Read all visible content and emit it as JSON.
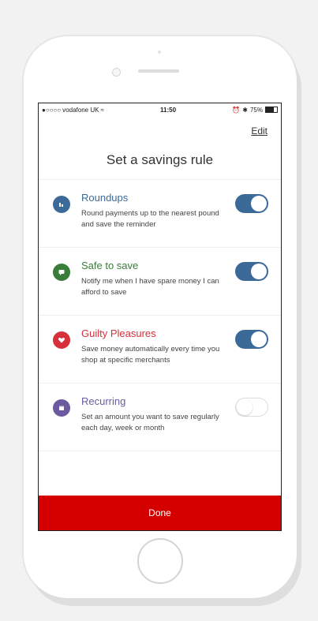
{
  "status": {
    "signal": "●○○○○",
    "carrier": "vodafone UK",
    "wifi": "≈",
    "time": "11:50",
    "alarm": "⏰",
    "bluetooth": "✱",
    "battery": "75%"
  },
  "header": {
    "edit_label": "Edit",
    "title": "Set a savings rule"
  },
  "rules": [
    {
      "name": "Roundups",
      "description": "Round payments up to the nearest pound and save the reminder",
      "icon": "roundups-icon",
      "color": "#3b6a99",
      "enabled": true
    },
    {
      "name": "Safe to save",
      "description": "Notify me when I have spare money I can afford to save",
      "icon": "chat-icon",
      "color": "#3a7d3a",
      "enabled": true
    },
    {
      "name": "Guilty Pleasures",
      "description": "Save money automatically every time you shop at specific merchants",
      "icon": "heart-icon",
      "color": "#d6303a",
      "enabled": true
    },
    {
      "name": "Recurring",
      "description": "Set an amount you want to save regularly each day, week or month",
      "icon": "calendar-icon",
      "color": "#6b5aa0",
      "enabled": false
    }
  ],
  "footer": {
    "done_label": "Done"
  }
}
